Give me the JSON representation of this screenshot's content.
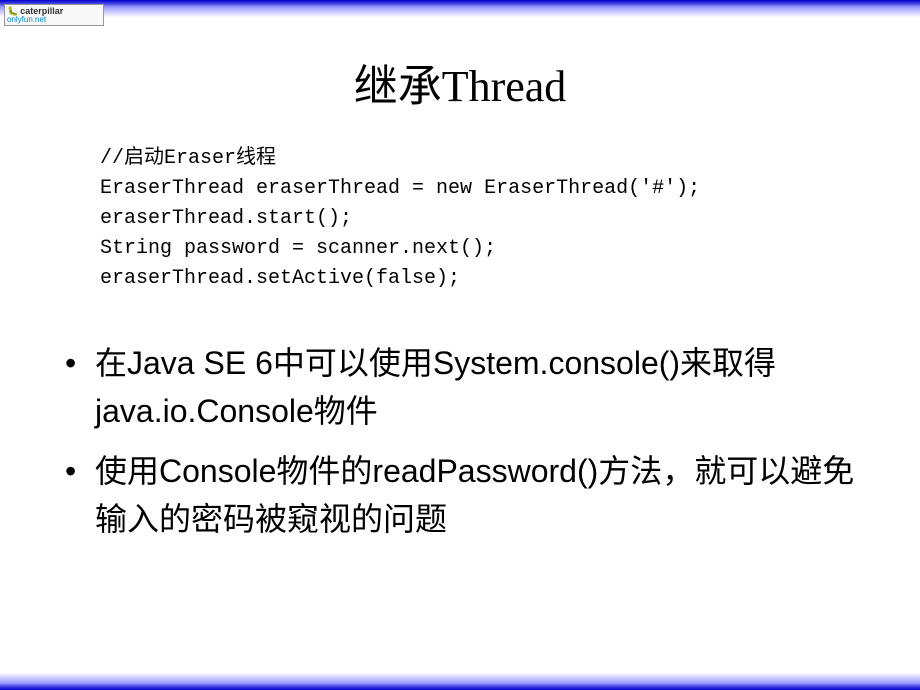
{
  "logo": {
    "top": "caterpillar",
    "bottom": "onlyfun.net"
  },
  "title": "继承Thread",
  "code": "//启动Eraser线程\nEraserThread eraserThread = new EraserThread('#');\neraserThread.start();\nString password = scanner.next();\neraserThread.setActive(false);",
  "bullets": [
    "在Java SE 6中可以使用System.console()来取得java.io.Console物件",
    "使用Console物件的readPassword()方法，就可以避免输入的密码被窥视的问题"
  ]
}
